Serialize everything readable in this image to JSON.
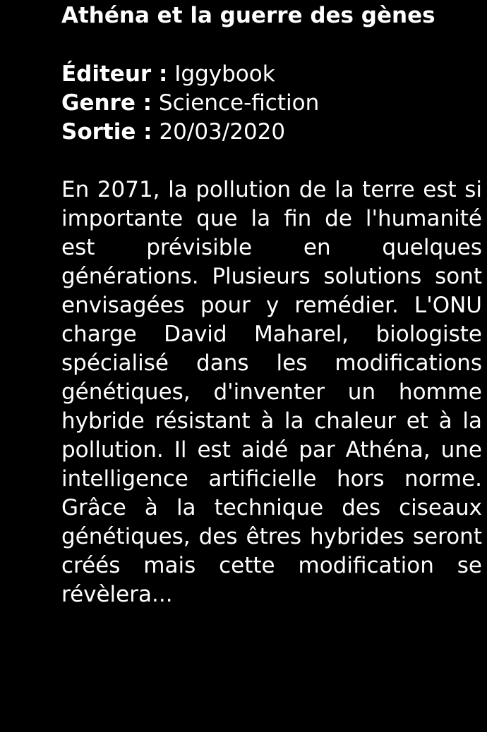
{
  "book": {
    "title": "Athéna et la guerre des gènes",
    "publisher_label": "Éditeur :",
    "publisher": "Iggybook",
    "genre_label": "Genre :",
    "genre": "Science-fiction",
    "release_label": "Sortie :",
    "release_date": "20/03/2020",
    "synopsis": "En 2071, la pollution de la terre est si importante que la fin de l'humanité est prévisible en quelques générations. Plusieurs solutions sont envisagées pour y remédier. L'ONU charge David Maharel, biologiste spécialisé dans les modifications génétiques, d'inventer un homme hybride résistant à la chaleur et à la pollution. Il est aidé par Athéna, une intelligence artificielle hors norme. Grâce à la technique des ciseaux génétiques, des êtres hybrides seront créés mais cette modification se révèlera..."
  },
  "colors": {
    "background": "#000000",
    "text": "#ffffff"
  }
}
